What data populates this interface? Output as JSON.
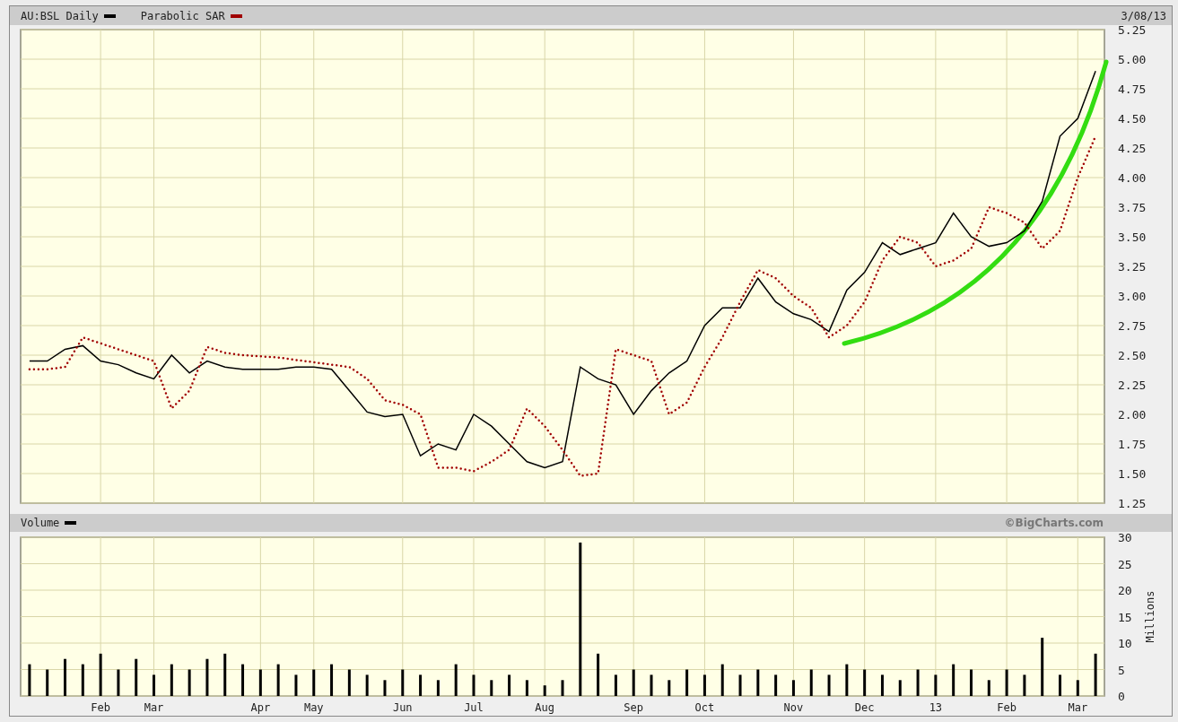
{
  "price_panel": {
    "date": "3/08/13",
    "chart_data": {
      "type": "line",
      "categories": [
        null,
        null,
        null,
        null,
        null,
        null,
        null,
        null,
        null,
        null,
        null,
        null,
        null,
        null,
        null,
        null,
        null,
        null,
        null,
        null,
        null,
        null,
        null,
        null,
        null,
        null,
        null,
        null,
        null,
        null,
        null,
        null,
        null,
        null,
        null,
        null,
        null,
        null,
        null,
        null,
        null,
        null,
        null,
        null,
        null,
        null,
        null,
        null,
        null,
        null,
        null,
        null,
        null,
        null,
        null,
        null,
        null,
        null,
        null,
        null,
        null
      ],
      "series": [
        {
          "name": "AU:BSL Daily",
          "color": "#000000",
          "line_style": "solid",
          "values": [
            2.45,
            2.45,
            2.55,
            2.58,
            2.45,
            2.42,
            2.35,
            2.3,
            2.5,
            2.35,
            2.45,
            2.4,
            2.38,
            2.38,
            2.38,
            2.4,
            2.4,
            2.38,
            2.2,
            2.02,
            1.98,
            2.0,
            1.65,
            1.75,
            1.7,
            2.0,
            1.9,
            1.75,
            1.6,
            1.55,
            1.6,
            2.4,
            2.3,
            2.25,
            2.0,
            2.2,
            2.35,
            2.45,
            2.75,
            2.9,
            2.9,
            3.15,
            2.95,
            2.85,
            2.8,
            2.7,
            3.05,
            3.2,
            3.45,
            3.35,
            3.4,
            3.45,
            3.7,
            3.5,
            3.42,
            3.45,
            3.55,
            3.8,
            4.35,
            4.5,
            4.9
          ]
        },
        {
          "name": "Parabolic SAR",
          "color": "#a00000",
          "line_style": "dotted",
          "values": [
            2.38,
            2.38,
            2.4,
            2.65,
            2.6,
            2.55,
            2.5,
            2.45,
            2.05,
            2.2,
            2.57,
            2.52,
            2.5,
            2.49,
            2.48,
            2.46,
            2.44,
            2.42,
            2.4,
            2.3,
            2.12,
            2.08,
            2.0,
            1.55,
            1.55,
            1.52,
            1.6,
            1.7,
            2.05,
            1.9,
            1.7,
            1.48,
            1.5,
            2.55,
            2.5,
            2.45,
            2.0,
            2.1,
            2.4,
            2.65,
            2.95,
            3.22,
            3.15,
            3.0,
            2.9,
            2.65,
            2.75,
            2.95,
            3.3,
            3.5,
            3.45,
            3.25,
            3.3,
            3.4,
            3.75,
            3.7,
            3.62,
            3.4,
            3.55,
            4.0,
            4.35
          ]
        }
      ],
      "ylim": [
        1.25,
        5.25
      ],
      "grid": true,
      "yticks": [
        {
          "value": 1.25,
          "label": "1.25"
        },
        {
          "value": 1.5,
          "label": "1.50"
        },
        {
          "value": 1.75,
          "label": "1.75"
        },
        {
          "value": 2,
          "label": "2.00"
        },
        {
          "value": 2.25,
          "label": "2.25"
        },
        {
          "value": 2.5,
          "label": "2.50"
        },
        {
          "value": 2.75,
          "label": "2.75"
        },
        {
          "value": 3,
          "label": "3.00"
        },
        {
          "value": 3.25,
          "label": "3.25"
        },
        {
          "value": 3.5,
          "label": "3.50"
        },
        {
          "value": 3.75,
          "label": "3.75"
        },
        {
          "value": 4,
          "label": "4.00"
        },
        {
          "value": 4.25,
          "label": "4.25"
        },
        {
          "value": 4.5,
          "label": "4.50"
        },
        {
          "value": 4.75,
          "label": "4.75"
        },
        {
          "value": 5,
          "label": "5.00"
        },
        {
          "value": 5.25,
          "label": "5.25"
        }
      ]
    }
  },
  "volume_panel": {
    "credit": "©BigCharts.com",
    "chart_data": {
      "type": "bar",
      "ylabel": "Millions",
      "categories": [
        null,
        null,
        null,
        null,
        "Feb",
        null,
        null,
        "Mar",
        null,
        null,
        null,
        null,
        null,
        "Apr",
        null,
        null,
        "May",
        null,
        null,
        null,
        null,
        "Jun",
        null,
        null,
        null,
        "Jul",
        null,
        null,
        null,
        "Aug",
        null,
        null,
        null,
        null,
        "Sep",
        null,
        null,
        null,
        "Oct",
        null,
        null,
        null,
        null,
        "Nov",
        null,
        null,
        null,
        "Dec",
        null,
        null,
        null,
        "13",
        null,
        null,
        null,
        "Feb",
        null,
        null,
        null,
        "Mar",
        null
      ],
      "series": [
        {
          "name": "Volume",
          "color": "#000000",
          "values": [
            6,
            5,
            7,
            6,
            8,
            5,
            7,
            4,
            6,
            5,
            7,
            8,
            6,
            5,
            6,
            4,
            5,
            6,
            5,
            4,
            3,
            5,
            4,
            3,
            6,
            4,
            3,
            4,
            3,
            2,
            3,
            29,
            8,
            4,
            5,
            4,
            3,
            5,
            4,
            6,
            4,
            5,
            4,
            3,
            5,
            4,
            6,
            5,
            4,
            3,
            5,
            4,
            6,
            5,
            3,
            5,
            4,
            11,
            4,
            3,
            8
          ]
        }
      ],
      "ylim": [
        0,
        30
      ],
      "grid": true,
      "yticks": [
        0,
        5,
        10,
        15,
        20,
        25,
        30
      ]
    }
  }
}
